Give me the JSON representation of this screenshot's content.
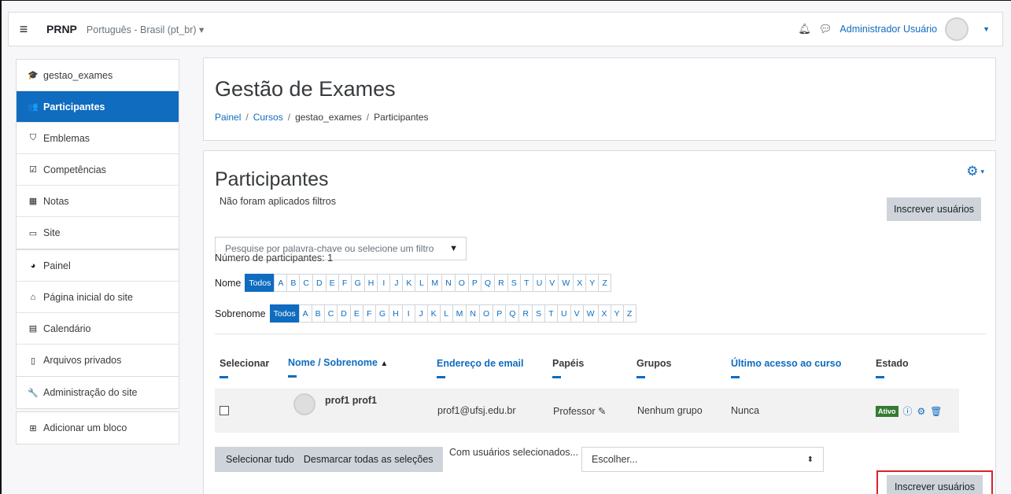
{
  "navbar": {
    "brand": "PRNP",
    "language": "Português - Brasil (pt_br)",
    "user_name": "Administrador Usuário"
  },
  "sidebar": {
    "group1": [
      {
        "icon": "graduation-cap-icon",
        "glyph": "🎓",
        "label": "gestao_exames",
        "active": false
      },
      {
        "icon": "users-icon",
        "glyph": "👥",
        "label": "Participantes",
        "active": true
      },
      {
        "icon": "shield-icon",
        "glyph": "⛉",
        "label": "Emblemas",
        "active": false
      },
      {
        "icon": "check-square-icon",
        "glyph": "☑",
        "label": "Competências",
        "active": false
      },
      {
        "icon": "table-icon",
        "glyph": "▦",
        "label": "Notas",
        "active": false
      },
      {
        "icon": "folder-icon",
        "glyph": "▭",
        "label": "Site",
        "active": false
      }
    ],
    "group2": [
      {
        "icon": "dashboard-icon",
        "glyph": "◕",
        "label": "Painel"
      },
      {
        "icon": "home-icon",
        "glyph": "⌂",
        "label": "Página inicial do site"
      },
      {
        "icon": "calendar-icon",
        "glyph": "▤",
        "label": "Calendário"
      },
      {
        "icon": "file-icon",
        "glyph": "▯",
        "label": "Arquivos privados"
      }
    ],
    "group3": [
      {
        "icon": "wrench-icon",
        "glyph": "🔧",
        "label": "Administração do site"
      }
    ],
    "group4": [
      {
        "icon": "plus-square-icon",
        "glyph": "⊞",
        "label": "Adicionar um bloco"
      }
    ]
  },
  "header": {
    "title": "Gestão de Exames",
    "breadcrumb": [
      "Painel",
      "Cursos",
      "gestao_exames",
      "Participantes"
    ]
  },
  "participants": {
    "title": "Participantes",
    "no_filters": "Não foram aplicados filtros",
    "enrol_label": "Inscrever usuários",
    "filter_placeholder": "Pesquise por palavra-chave ou selecione um filtro",
    "count_label": "Número de participantes: 1",
    "first_name_label": "Nome",
    "last_name_label": "Sobrenome",
    "all_label": "Todos",
    "letters": [
      "A",
      "B",
      "C",
      "D",
      "E",
      "F",
      "G",
      "H",
      "I",
      "J",
      "K",
      "L",
      "M",
      "N",
      "O",
      "P",
      "Q",
      "R",
      "S",
      "T",
      "U",
      "V",
      "W",
      "X",
      "Y",
      "Z"
    ],
    "columns": {
      "select": "Selecionar",
      "name": "Nome / Sobrenome",
      "email": "Endereço de email",
      "roles": "Papéis",
      "groups": "Grupos",
      "last_access": "Último acesso ao curso",
      "status": "Estado"
    },
    "rows": [
      {
        "name": "prof1 prof1",
        "email": "prof1@ufsj.edu.br",
        "role": "Professor",
        "group": "Nenhum grupo",
        "last_access": "Nunca",
        "status": "Ativo"
      }
    ],
    "select_all": "Selecionar tudo",
    "deselect_all": "Desmarcar todas as seleções",
    "with_selected": "Com usuários selecionados...",
    "choose": "Escolher..."
  },
  "colors": {
    "primary": "#0f6cbf",
    "active_badge": "#357a32",
    "highlight": "#d9232d"
  }
}
